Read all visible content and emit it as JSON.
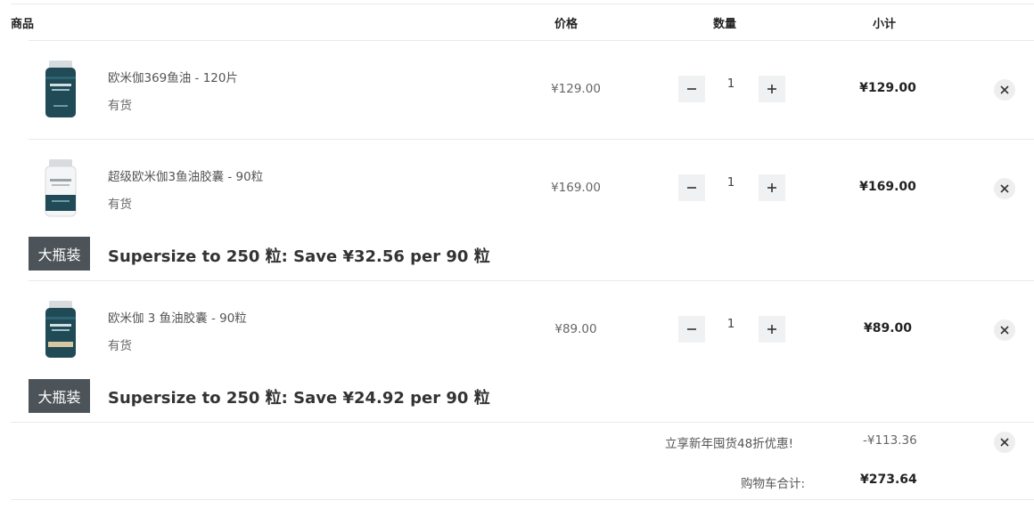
{
  "header": {
    "product_label": "商品",
    "price_label": "价格",
    "qty_label": "数量",
    "subtotal_label": "小计"
  },
  "items": [
    {
      "name": "欧米伽369鱼油 - 120片",
      "stock": "有货",
      "price": "¥129.00",
      "qty": "1",
      "subtotal": "¥129.00",
      "image_icon": "dark-supplement-bottle-icon"
    },
    {
      "name": "超级欧米伽3鱼油胶囊 - 90粒",
      "stock": "有货",
      "price": "¥169.00",
      "qty": "1",
      "subtotal": "¥169.00",
      "image_icon": "white-supplement-bottle-icon",
      "upsell": {
        "badge": "大瓶装",
        "text": "Supersize to 250 粒: Save ¥32.56 per 90 粒"
      }
    },
    {
      "name": "欧米伽 3 鱼油胶囊 - 90粒",
      "stock": "有货",
      "price": "¥89.00",
      "qty": "1",
      "subtotal": "¥89.00",
      "image_icon": "dark-supplement-bottle-icon",
      "upsell": {
        "badge": "大瓶装",
        "text": "Supersize to 250 粒: Save ¥24.92 per 90 粒"
      }
    }
  ],
  "discount": {
    "label": "立享新年囤货48折优惠!",
    "value": "-¥113.36"
  },
  "total": {
    "label": "购物车合计:",
    "value": "¥273.64"
  },
  "icons": {
    "minus": "minus-icon",
    "plus": "plus-icon",
    "remove": "close-icon"
  },
  "colors": {
    "badge_bg": "#4d5459",
    "button_bg": "#f0f1f2",
    "divider": "#e9e9e9",
    "bottle_dark": "#1f4a56"
  }
}
